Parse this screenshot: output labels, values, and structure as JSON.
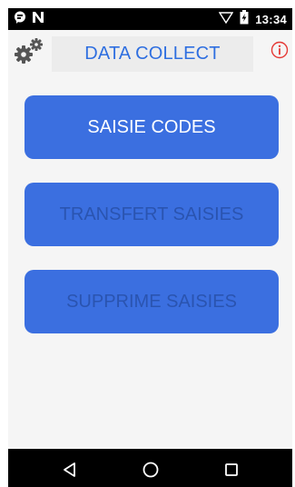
{
  "status_bar": {
    "time": "13:34",
    "icons": [
      "notification-chat-icon",
      "n-letter-icon",
      "wifi-icon",
      "battery-icon"
    ]
  },
  "header": {
    "title": "DATA COLLECT",
    "left_icon": "gear-icon",
    "right_icon": "info-icon"
  },
  "buttons": [
    {
      "label": "SAISIE CODES",
      "enabled": true
    },
    {
      "label": "TRANSFERT SAISIES",
      "enabled": false
    },
    {
      "label": "SUPPRIME SAISIES",
      "enabled": false
    }
  ],
  "nav_bar": {
    "icons": [
      "back-icon",
      "home-icon",
      "recents-icon"
    ]
  },
  "colors": {
    "accent": "#3b6fe0",
    "title_text": "#2f6fe0",
    "disabled_text": "#2a54b0",
    "info_red": "#e53935",
    "background": "#f5f5f5"
  }
}
